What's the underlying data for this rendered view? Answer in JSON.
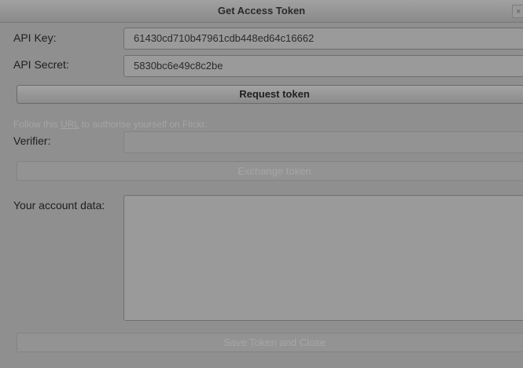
{
  "window": {
    "title": "Get Access Token",
    "close_glyph": "×"
  },
  "form": {
    "api_key_label": "API Key:",
    "api_key_value": "61430cd710b47961cdb448ed64c16662",
    "api_secret_label": "API Secret:",
    "api_secret_value": "5830bc6e49c8c2be",
    "request_button": "Request token",
    "hint_before": "Follow this ",
    "hint_link": "URL",
    "hint_after": " to authorise yourself on Flickr.",
    "verifier_label": "Verifier:",
    "verifier_value": "",
    "exchange_button": "Exchange token",
    "account_label": "Your account data:",
    "account_value": "",
    "save_button": "Save Token and Close"
  },
  "icons": {
    "close": "close-icon"
  }
}
